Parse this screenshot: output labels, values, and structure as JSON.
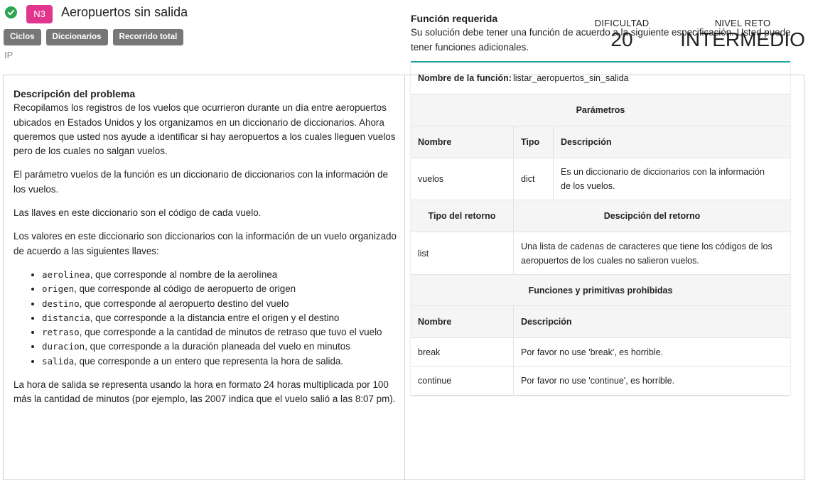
{
  "header": {
    "title": "Aeropuertos sin salida",
    "level_badge": "N3",
    "tags": [
      "Ciclos",
      "Diccionarios",
      "Recorrido total"
    ],
    "course": "IP",
    "difficulty_label": "DIFICULTAD",
    "difficulty_value": "20",
    "reto_label": "NIVEL RETO",
    "reto_value": "INTERMEDIO"
  },
  "description": {
    "title": "Descripción del problema",
    "p1": "Recopilamos los registros de los vuelos que ocurrieron durante un día entre aeropuertos ubicados en Estados Unidos y los organizamos en un diccionario de diccionarios. Ahora queremos que usted nos ayude a identificar si hay aeropuertos a los cuales lleguen vuelos pero de los cuales no salgan vuelos.",
    "p2": "El parámetro vuelos de la función es un diccionario de diccionarios con la información de los vuelos.",
    "p3": "Las llaves en este diccionario son el código de cada vuelo.",
    "p4": "Los valores en este diccionario son diccionarios con la información de un vuelo organizado de acuerdo a las siguientes llaves:",
    "keys": [
      {
        "code": "aerolinea",
        "text": ", que corresponde al nombre de la aerolínea"
      },
      {
        "code": "origen",
        "text": ", que corresponde al código de aeropuerto de origen"
      },
      {
        "code": "destino",
        "text": ", que corresponde al aeropuerto destino del vuelo"
      },
      {
        "code": "distancia",
        "text": ", que corresponde a la distancia entre el origen y el destino"
      },
      {
        "code": "retraso",
        "text": ", que corresponde a la cantidad de minutos de retraso que tuvo el vuelo"
      },
      {
        "code": "duracion",
        "text": ", que corresponde a la duración planeada del vuelo en minutos"
      },
      {
        "code": "salida",
        "text": ", que corresponde a un entero que representa la hora de salida."
      }
    ],
    "p5": "La hora de salida se representa usando la hora en formato 24 horas multiplicada por 100 más la cantidad de minutos (por ejemplo, las 2007 indica que el vuelo salió a las 8:07 pm)."
  },
  "function": {
    "title": "Función requerida",
    "intro": "Su solución debe tener una función de acuerdo a la siguiente especificación. Usted puede tener funciones adicionales.",
    "name_label": "Nombre de la función:",
    "name_value": "listar_aeropuertos_sin_salida",
    "params_header": "Parámetros",
    "col_nombre": "Nombre",
    "col_tipo": "Tipo",
    "col_desc": "Descripción",
    "param": {
      "name": "vuelos",
      "type": "dict",
      "desc": "Es un diccionario de diccionarios con la información de los vuelos."
    },
    "return_type_label": "Tipo del retorno",
    "return_desc_label": "Descipción del retorno",
    "return": {
      "type": "list",
      "desc": "Una lista de cadenas de caracteres que tiene los códigos de los aeropuertos de los cuales no salieron vuelos."
    },
    "forbidden_header": "Funciones y primitivas prohibidas",
    "forbidden_col_name": "Nombre",
    "forbidden_col_desc": "Descripción",
    "forbidden": [
      {
        "name": "break",
        "desc": "Por favor no use 'break', es horrible."
      },
      {
        "name": "continue",
        "desc": "Por favor no use 'continue', es horrible."
      }
    ]
  },
  "colors": {
    "badge": "#e0368e",
    "check": "#2ea44f",
    "tag": "#777777",
    "accent": "#1aa39b"
  }
}
